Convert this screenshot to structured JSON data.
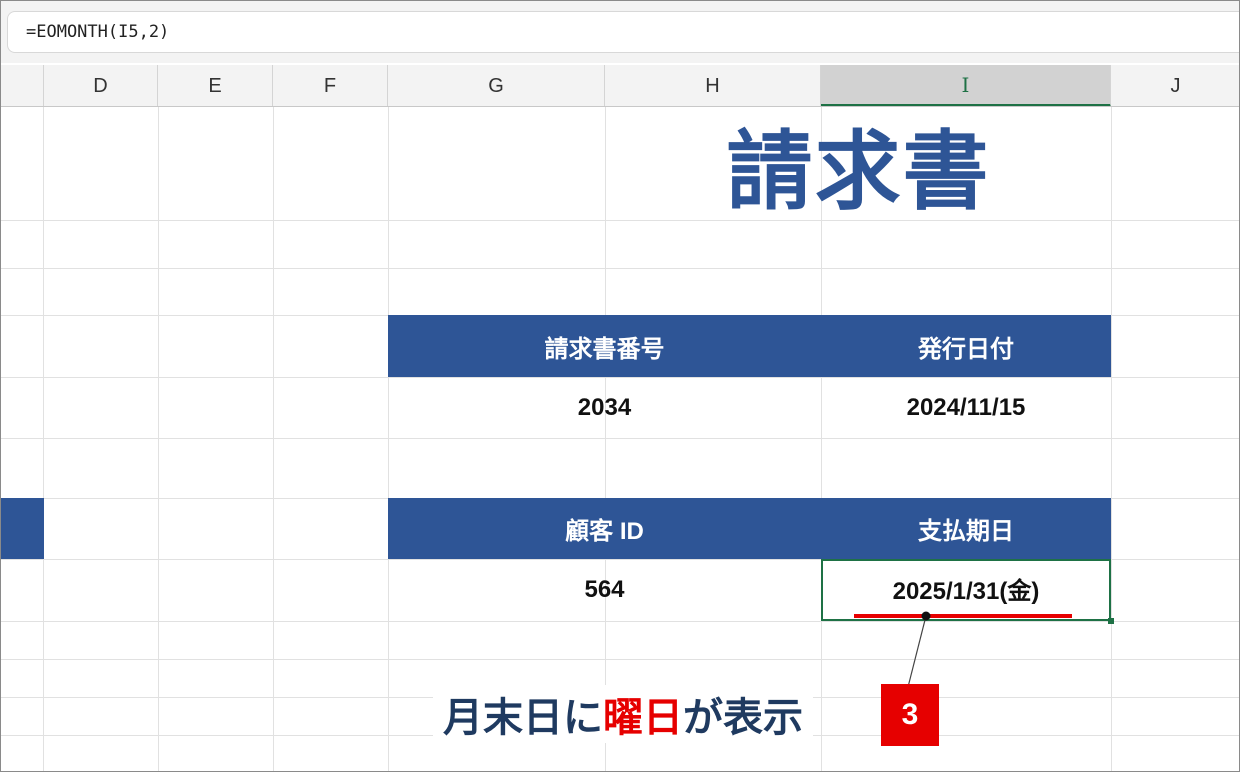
{
  "formula_bar": {
    "formula": "=EOMONTH(I5,2)"
  },
  "columns": [
    "D",
    "E",
    "F",
    "G",
    "H",
    "I",
    "J"
  ],
  "selected_column": "I",
  "invoice": {
    "title": "請求書",
    "header_row1": [
      "請求書番号",
      "発行日付"
    ],
    "values_row1": [
      "2034",
      "2024/11/15"
    ],
    "header_row2": [
      "顧客 ID",
      "支払期日"
    ],
    "values_row2": [
      "564",
      "2025/1/31(金)"
    ]
  },
  "annotation": {
    "text_before": "月末日に",
    "text_highlight": "曜日",
    "text_after": "が表示",
    "step": "3"
  },
  "colors": {
    "header_fill": "#2e5596",
    "title": "#2e5596",
    "selection": "#1e7145",
    "highlight": "#e60000"
  }
}
